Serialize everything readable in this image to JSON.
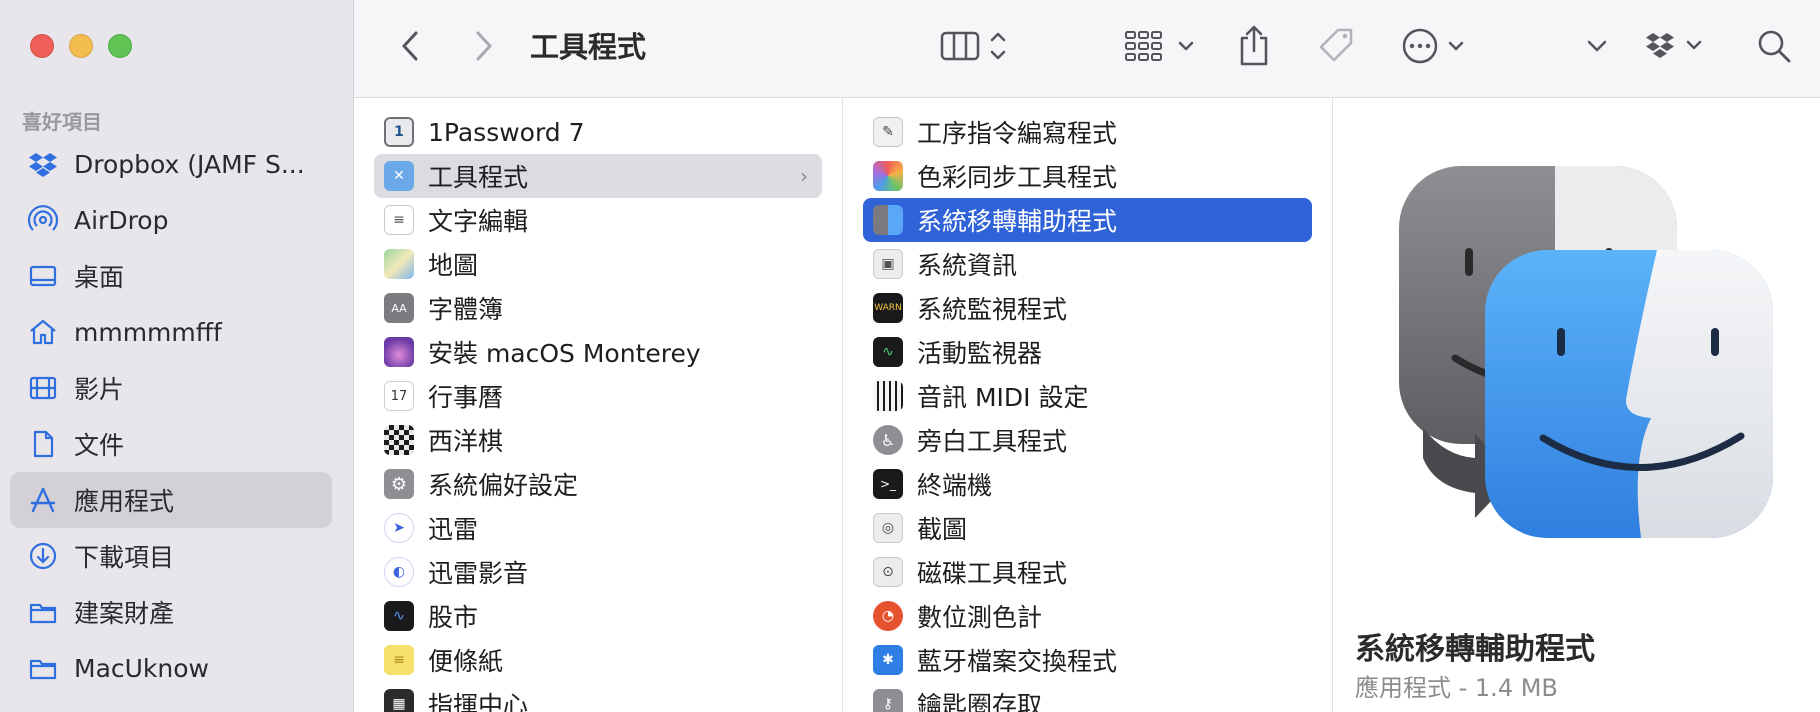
{
  "window": {
    "title": "工具程式"
  },
  "sidebar": {
    "section_label": "喜好項目",
    "items": [
      {
        "label": "Dropbox (JAMF S...",
        "icon": "dropbox-icon"
      },
      {
        "label": "AirDrop",
        "icon": "airdrop-icon"
      },
      {
        "label": "桌面",
        "icon": "desktop-icon"
      },
      {
        "label": "mmmmmfff",
        "icon": "home-icon"
      },
      {
        "label": "影片",
        "icon": "film-icon"
      },
      {
        "label": "文件",
        "icon": "document-icon"
      },
      {
        "label": "應用程式",
        "icon": "applications-icon",
        "selected": true
      },
      {
        "label": "下載項目",
        "icon": "downloads-icon"
      },
      {
        "label": "建案財產",
        "icon": "folder-icon"
      },
      {
        "label": "MacUknow",
        "icon": "folder-icon"
      }
    ]
  },
  "column1": {
    "items": [
      {
        "label": "1Password 7"
      },
      {
        "label": "工具程式",
        "selected": true
      },
      {
        "label": "文字編輯"
      },
      {
        "label": "地圖"
      },
      {
        "label": "字體簿"
      },
      {
        "label": "安裝 macOS Monterey"
      },
      {
        "label": "行事曆"
      },
      {
        "label": "西洋棋"
      },
      {
        "label": "系統偏好設定"
      },
      {
        "label": "迅雷"
      },
      {
        "label": "迅雷影音"
      },
      {
        "label": "股市"
      },
      {
        "label": "便條紙"
      },
      {
        "label": "指揮中心"
      }
    ]
  },
  "column2": {
    "items": [
      {
        "label": "工序指令編寫程式"
      },
      {
        "label": "色彩同步工具程式"
      },
      {
        "label": "系統移轉輔助程式",
        "selected": true
      },
      {
        "label": "系統資訊"
      },
      {
        "label": "系統監視程式"
      },
      {
        "label": "活動監視器"
      },
      {
        "label": "音訊 MIDI 設定"
      },
      {
        "label": "旁白工具程式"
      },
      {
        "label": "終端機"
      },
      {
        "label": "截圖"
      },
      {
        "label": "磁碟工具程式"
      },
      {
        "label": "數位測色計"
      },
      {
        "label": "藍牙檔案交換程式"
      },
      {
        "label": "鑰匙圈存取"
      }
    ]
  },
  "preview": {
    "name": "系統移轉輔助程式",
    "meta": "應用程式 - 1.4 MB"
  },
  "colors": {
    "accent": "#2f63d7",
    "sidebar_bg": "#e8e6ea",
    "traffic_close": "#ed5f57",
    "traffic_minimize": "#f4bd4f",
    "traffic_zoom": "#5fc454"
  }
}
